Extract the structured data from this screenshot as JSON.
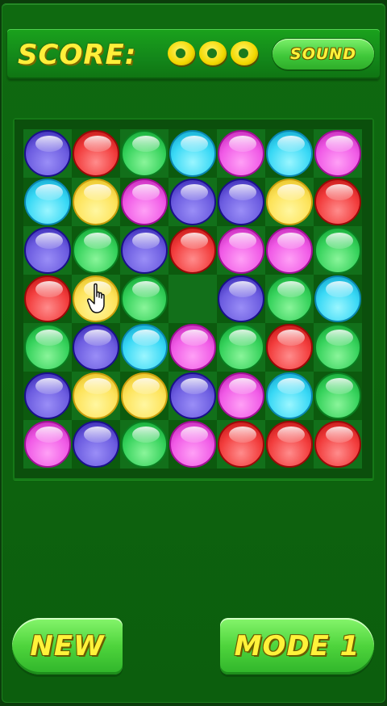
{
  "header": {
    "score_label": "SCORE:",
    "score_digits": [
      "0",
      "0",
      "0"
    ],
    "sound_label": "SOUND"
  },
  "board": {
    "rows": 7,
    "cols": 7,
    "grid": [
      [
        "purple",
        "red",
        "green",
        "cyan",
        "magenta",
        "cyan",
        "magenta"
      ],
      [
        "cyan",
        "yellow",
        "magenta",
        "purple",
        "purple",
        "yellow",
        "red"
      ],
      [
        "purple",
        "green",
        "purple",
        "red",
        "magenta",
        "magenta",
        "green"
      ],
      [
        "red",
        "yellow",
        "green",
        "",
        "purple",
        "green",
        "cyan"
      ],
      [
        "green",
        "purple",
        "cyan",
        "magenta",
        "green",
        "red",
        "green"
      ],
      [
        "purple",
        "yellow",
        "yellow",
        "purple",
        "magenta",
        "cyan",
        "green"
      ],
      [
        "magenta",
        "purple",
        "green",
        "magenta",
        "red",
        "red",
        "red"
      ]
    ],
    "cursor_cell": {
      "row": 3,
      "col": 1
    },
    "cursor_icon": "hand-pointer-icon"
  },
  "controls": {
    "new_label": "NEW",
    "mode_label": "MODE 1"
  },
  "colors": {
    "background": "#0f6a10",
    "accent_text": "#fff23a",
    "button_green": "#4ed43c"
  }
}
